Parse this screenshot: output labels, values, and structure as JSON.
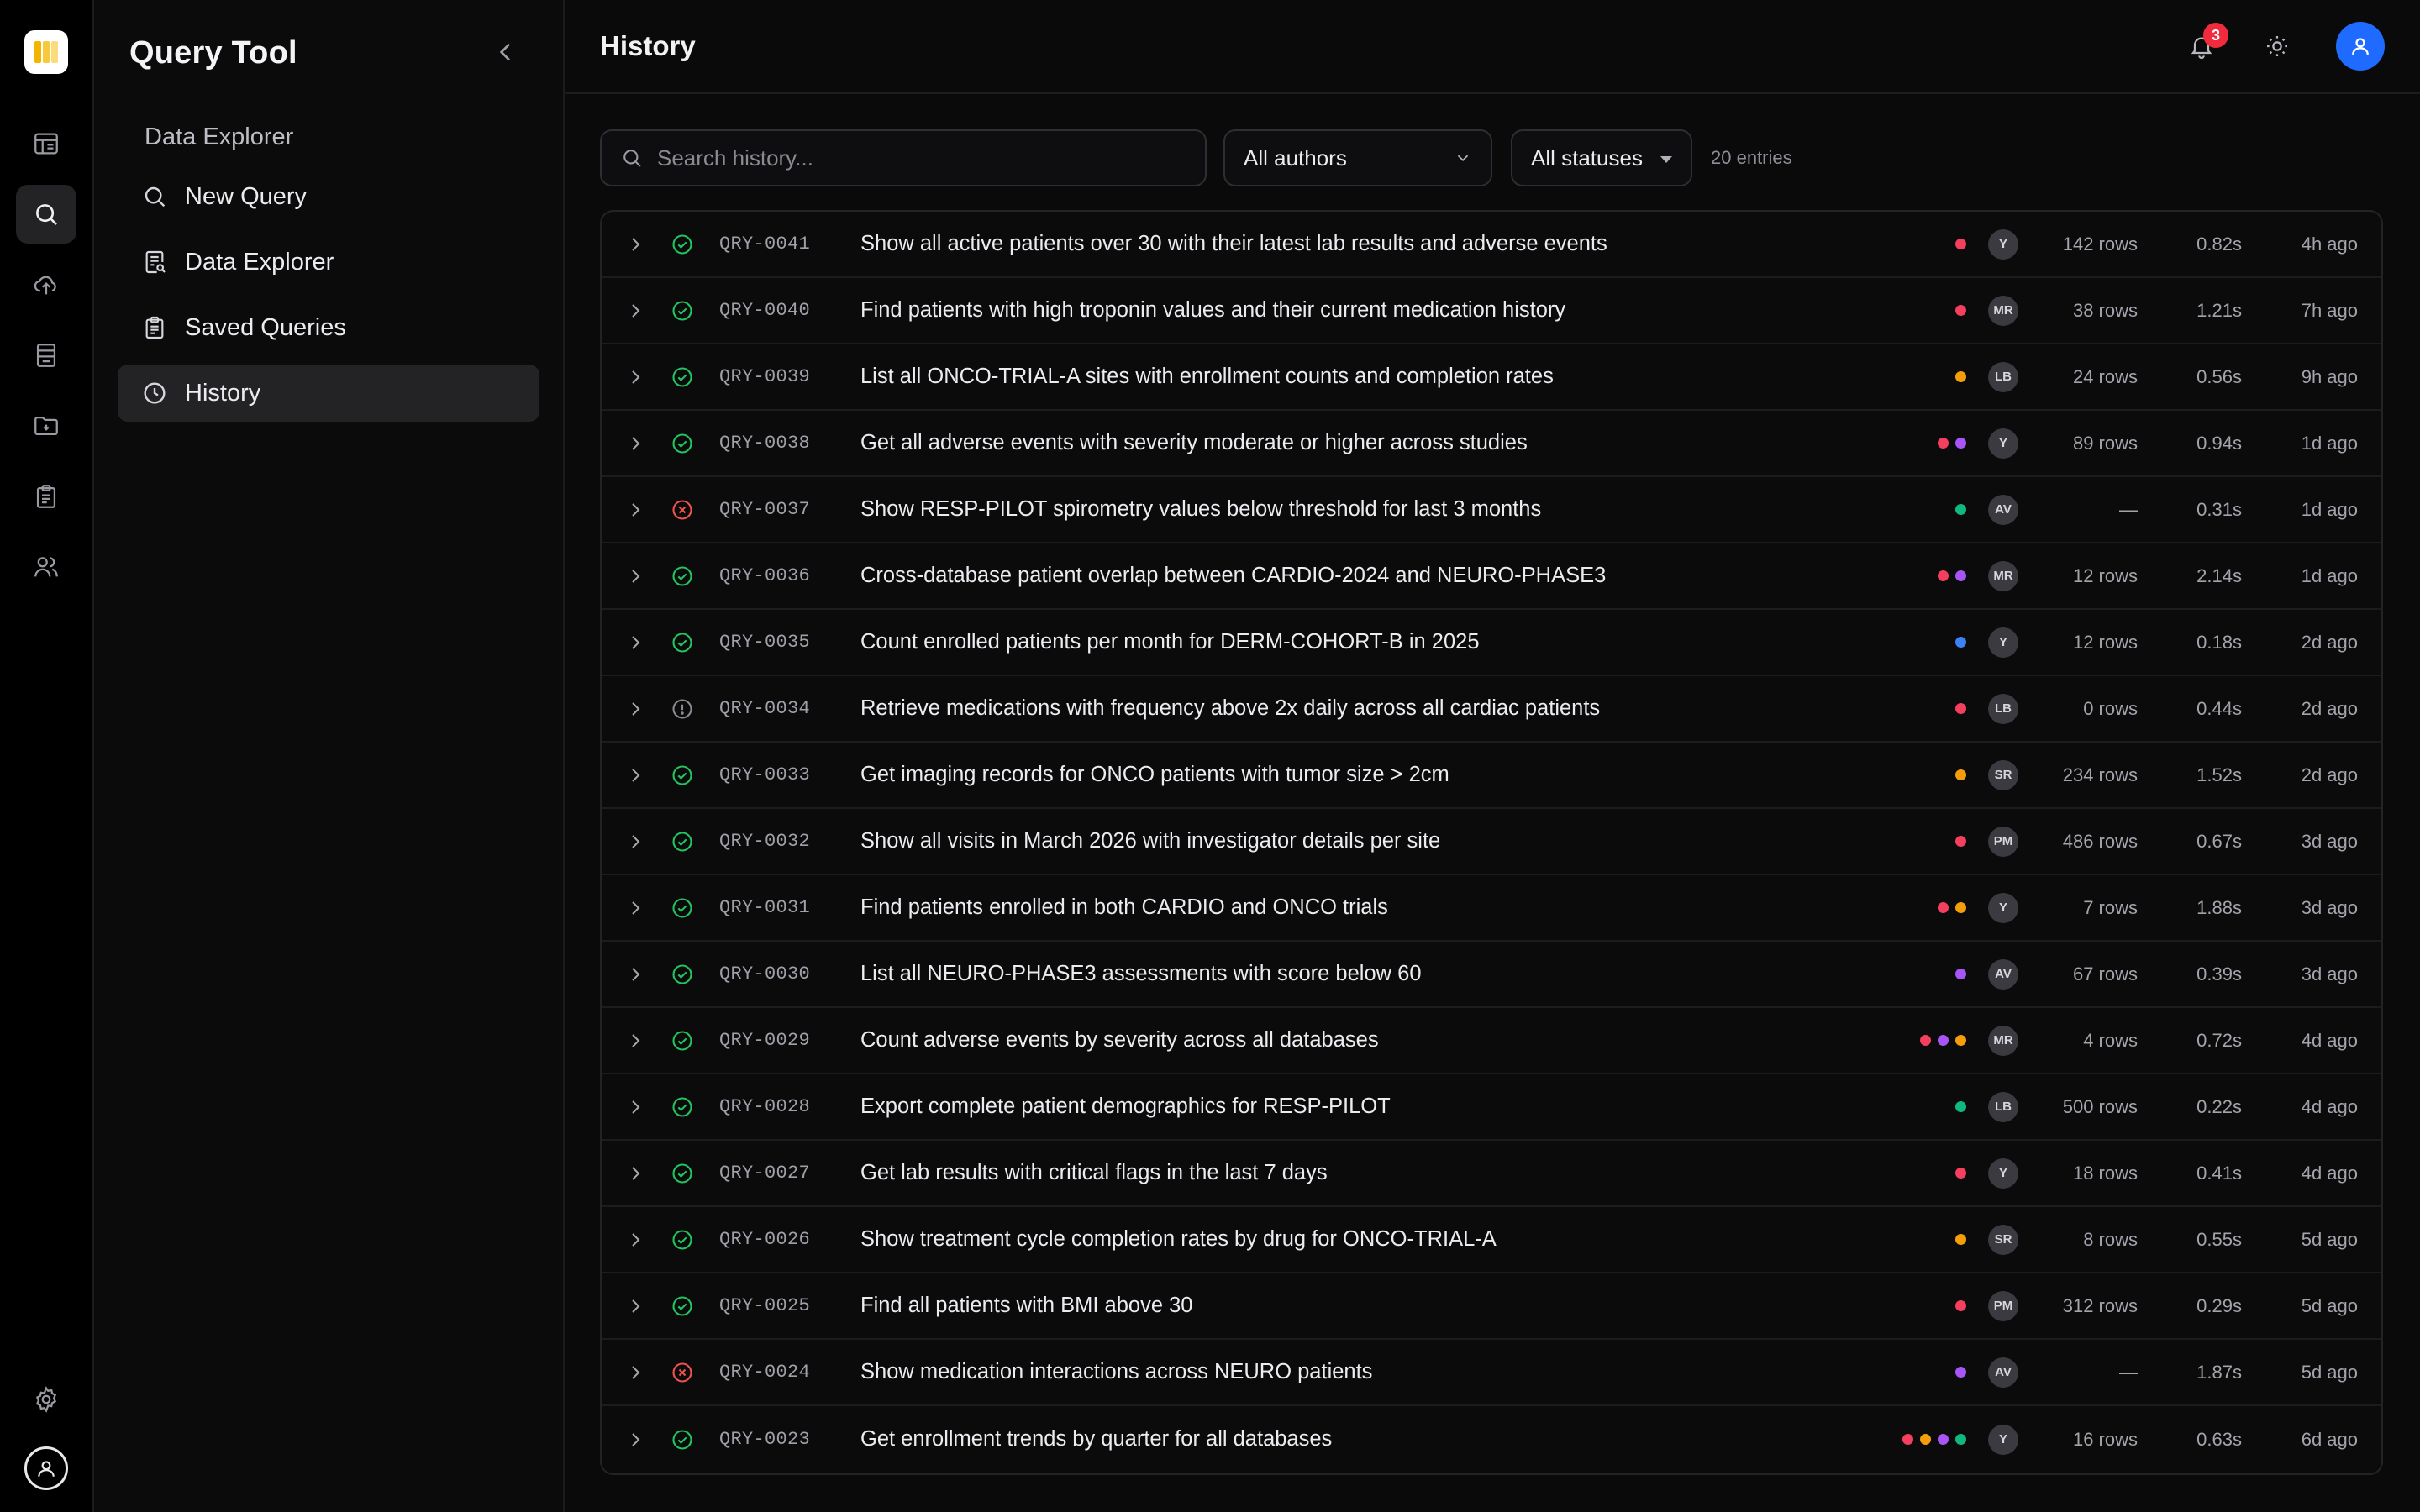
{
  "app": {
    "title": "Query Tool"
  },
  "sidebar": {
    "section_label": "Data Explorer",
    "items": [
      {
        "label": "New Query",
        "icon": "search-icon"
      },
      {
        "label": "Data Explorer",
        "icon": "data-explorer-icon"
      },
      {
        "label": "Saved Queries",
        "icon": "clipboard-icon"
      },
      {
        "label": "History",
        "icon": "clock-icon",
        "active": true
      }
    ]
  },
  "rail": {
    "icons": [
      "dashboard-icon",
      "search-icon",
      "upload-icon",
      "database-icon",
      "folder-icon",
      "clipboard-icon",
      "users-icon"
    ],
    "bottom_icons": [
      "settings-icon",
      "user-icon"
    ]
  },
  "header": {
    "title": "History",
    "notification_count": "3",
    "accent_color": "#1f6bff"
  },
  "filters": {
    "search_placeholder": "Search history...",
    "author_filter": "All authors",
    "status_filter": "All statuses",
    "entries_label": "20 entries"
  },
  "colors": {
    "success": "#22c55e",
    "error": "#f0534f",
    "warning": "#8a8a92",
    "db_red": "#f43f5e",
    "db_purple": "#a855f7",
    "db_orange": "#f59e0b",
    "db_green": "#10b981",
    "db_blue": "#3b82f6"
  },
  "history": [
    {
      "id": "QRY-0041",
      "status": "success",
      "description": "Show all active patients over 30 with their latest lab results and adverse events",
      "dbs": [
        "#f43f5e"
      ],
      "author": "Y",
      "rows": "142 rows",
      "duration": "0.82s",
      "ago": "4h ago"
    },
    {
      "id": "QRY-0040",
      "status": "success",
      "description": "Find patients with high troponin values and their current medication history",
      "dbs": [
        "#f43f5e"
      ],
      "author": "MR",
      "rows": "38 rows",
      "duration": "1.21s",
      "ago": "7h ago"
    },
    {
      "id": "QRY-0039",
      "status": "success",
      "description": "List all ONCO-TRIAL-A sites with enrollment counts and completion rates",
      "dbs": [
        "#f59e0b"
      ],
      "author": "LB",
      "rows": "24 rows",
      "duration": "0.56s",
      "ago": "9h ago"
    },
    {
      "id": "QRY-0038",
      "status": "success",
      "description": "Get all adverse events with severity moderate or higher across studies",
      "dbs": [
        "#f43f5e",
        "#a855f7"
      ],
      "author": "Y",
      "rows": "89 rows",
      "duration": "0.94s",
      "ago": "1d ago"
    },
    {
      "id": "QRY-0037",
      "status": "error",
      "description": "Show RESP-PILOT spirometry values below threshold for last 3 months",
      "dbs": [
        "#10b981"
      ],
      "author": "AV",
      "rows": "—",
      "duration": "0.31s",
      "ago": "1d ago"
    },
    {
      "id": "QRY-0036",
      "status": "success",
      "description": "Cross-database patient overlap between CARDIO-2024 and NEURO-PHASE3",
      "dbs": [
        "#f43f5e",
        "#a855f7"
      ],
      "author": "MR",
      "rows": "12 rows",
      "duration": "2.14s",
      "ago": "1d ago"
    },
    {
      "id": "QRY-0035",
      "status": "success",
      "description": "Count enrolled patients per month for DERM-COHORT-B in 2025",
      "dbs": [
        "#3b82f6"
      ],
      "author": "Y",
      "rows": "12 rows",
      "duration": "0.18s",
      "ago": "2d ago"
    },
    {
      "id": "QRY-0034",
      "status": "warning",
      "description": "Retrieve medications with frequency above 2x daily across all cardiac patients",
      "dbs": [
        "#f43f5e"
      ],
      "author": "LB",
      "rows": "0 rows",
      "duration": "0.44s",
      "ago": "2d ago"
    },
    {
      "id": "QRY-0033",
      "status": "success",
      "description": "Get imaging records for ONCO patients with tumor size > 2cm",
      "dbs": [
        "#f59e0b"
      ],
      "author": "SR",
      "rows": "234 rows",
      "duration": "1.52s",
      "ago": "2d ago"
    },
    {
      "id": "QRY-0032",
      "status": "success",
      "description": "Show all visits in March 2026 with investigator details per site",
      "dbs": [
        "#f43f5e"
      ],
      "author": "PM",
      "rows": "486 rows",
      "duration": "0.67s",
      "ago": "3d ago"
    },
    {
      "id": "QRY-0031",
      "status": "success",
      "description": "Find patients enrolled in both CARDIO and ONCO trials",
      "dbs": [
        "#f43f5e",
        "#f59e0b"
      ],
      "author": "Y",
      "rows": "7 rows",
      "duration": "1.88s",
      "ago": "3d ago"
    },
    {
      "id": "QRY-0030",
      "status": "success",
      "description": "List all NEURO-PHASE3 assessments with score below 60",
      "dbs": [
        "#a855f7"
      ],
      "author": "AV",
      "rows": "67 rows",
      "duration": "0.39s",
      "ago": "3d ago"
    },
    {
      "id": "QRY-0029",
      "status": "success",
      "description": "Count adverse events by severity across all databases",
      "dbs": [
        "#f43f5e",
        "#a855f7",
        "#f59e0b"
      ],
      "author": "MR",
      "rows": "4 rows",
      "duration": "0.72s",
      "ago": "4d ago"
    },
    {
      "id": "QRY-0028",
      "status": "success",
      "description": "Export complete patient demographics for RESP-PILOT",
      "dbs": [
        "#10b981"
      ],
      "author": "LB",
      "rows": "500 rows",
      "duration": "0.22s",
      "ago": "4d ago"
    },
    {
      "id": "QRY-0027",
      "status": "success",
      "description": "Get lab results with critical flags in the last 7 days",
      "dbs": [
        "#f43f5e"
      ],
      "author": "Y",
      "rows": "18 rows",
      "duration": "0.41s",
      "ago": "4d ago"
    },
    {
      "id": "QRY-0026",
      "status": "success",
      "description": "Show treatment cycle completion rates by drug for ONCO-TRIAL-A",
      "dbs": [
        "#f59e0b"
      ],
      "author": "SR",
      "rows": "8 rows",
      "duration": "0.55s",
      "ago": "5d ago"
    },
    {
      "id": "QRY-0025",
      "status": "success",
      "description": "Find all patients with BMI above 30",
      "dbs": [
        "#f43f5e"
      ],
      "author": "PM",
      "rows": "312 rows",
      "duration": "0.29s",
      "ago": "5d ago"
    },
    {
      "id": "QRY-0024",
      "status": "error",
      "description": "Show medication interactions across NEURO patients",
      "dbs": [
        "#a855f7"
      ],
      "author": "AV",
      "rows": "—",
      "duration": "1.87s",
      "ago": "5d ago"
    },
    {
      "id": "QRY-0023",
      "status": "success",
      "description": "Get enrollment trends by quarter for all databases",
      "dbs": [
        "#f43f5e",
        "#f59e0b",
        "#a855f7",
        "#10b981"
      ],
      "author": "Y",
      "rows": "16 rows",
      "duration": "0.63s",
      "ago": "6d ago"
    }
  ]
}
